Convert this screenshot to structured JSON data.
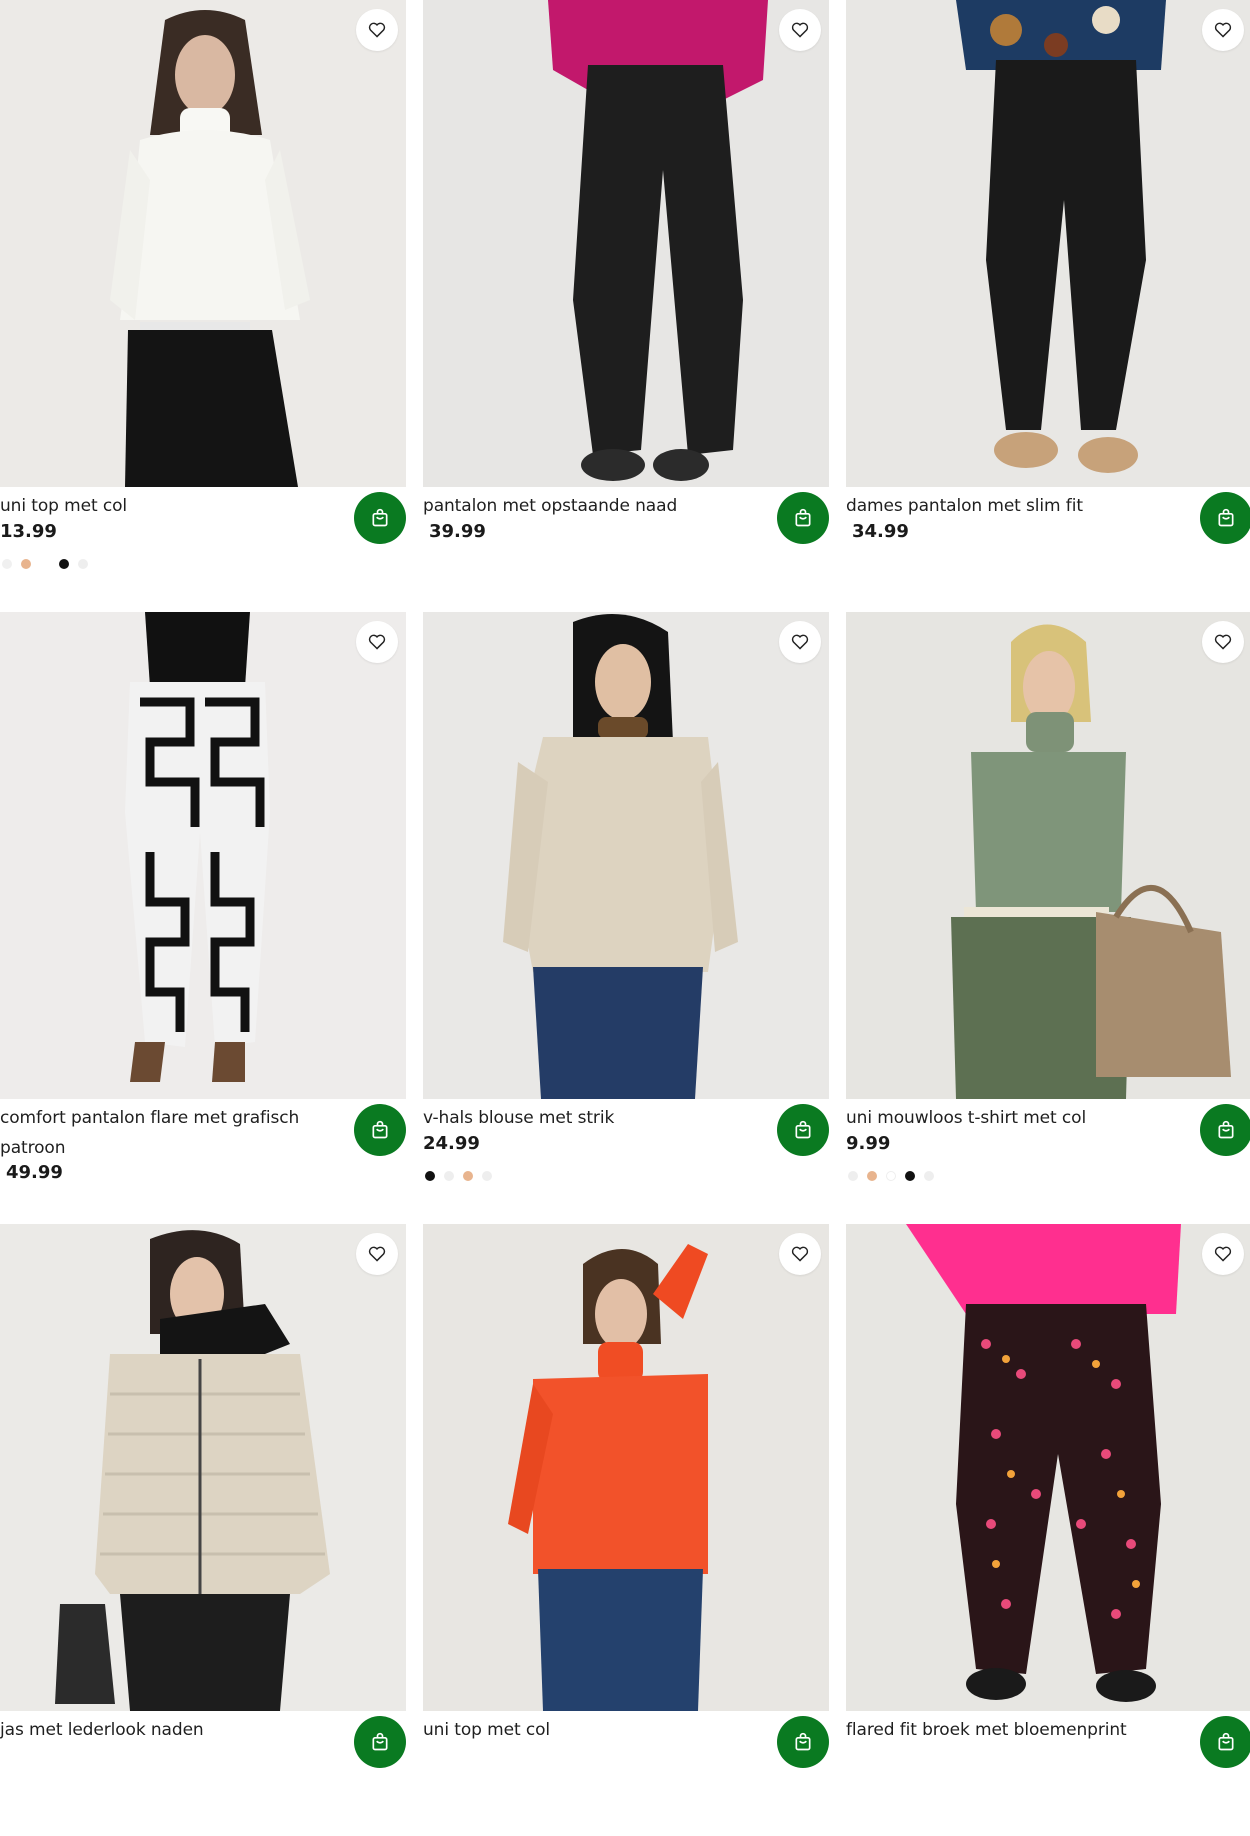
{
  "colors": {
    "cart_green": "#0a7a21",
    "favorite_icon": "heart-outline-icon",
    "cart_icon": "shopping-bag-icon"
  },
  "products": [
    {
      "name": "uni top met col",
      "price": "13.99",
      "swatches": [
        "#f0f0f0",
        "#e8b48e",
        "#ffffff",
        "#111111",
        "#eeeeee"
      ]
    },
    {
      "name": "pantalon met opstaande naad",
      "price": "39.99",
      "swatches": []
    },
    {
      "name": "dames pantalon met slim fit",
      "price": "34.99",
      "swatches": []
    },
    {
      "name": "comfort pantalon flare met grafisch patroon",
      "price": "49.99",
      "swatches": []
    },
    {
      "name": "v-hals blouse met strik",
      "price": "24.99",
      "swatches": [
        "#111111",
        "#eeeeee",
        "#e8b48e",
        "#eeeeee"
      ]
    },
    {
      "name": "uni mouwloos t-shirt met col",
      "price": "9.99",
      "swatches": [
        "#eeeeee",
        "#e8b48e",
        "#ffffff",
        "#111111",
        "#eeeeee"
      ]
    },
    {
      "name": "jas met lederlook naden",
      "price": "",
      "swatches": []
    },
    {
      "name": "uni top met col",
      "price": "",
      "swatches": []
    },
    {
      "name": "flared fit broek met bloemenprint",
      "price": "",
      "swatches": []
    }
  ]
}
